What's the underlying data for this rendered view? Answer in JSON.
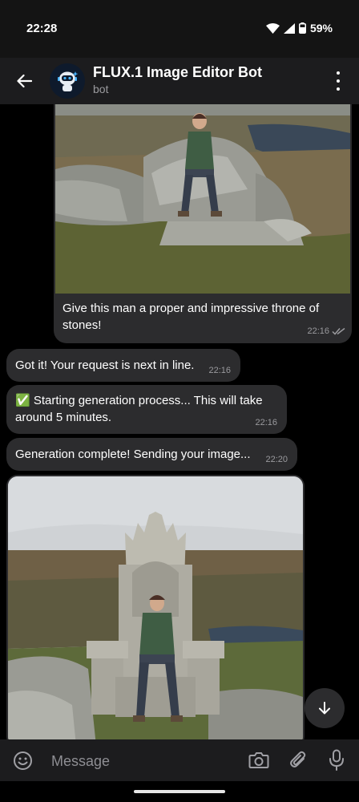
{
  "status_bar": {
    "time": "22:28",
    "battery": "59%",
    "icons": [
      "wifi-icon",
      "signal-icon",
      "battery-icon"
    ]
  },
  "header": {
    "title": "FLUX.1 Image Editor Bot",
    "subtitle": "bot",
    "icons": [
      "back-arrow-icon",
      "bot-avatar",
      "more-vert-icon"
    ]
  },
  "messages": [
    {
      "sender": "me",
      "has_image": true,
      "image_description": "man sitting on a pile of stones in a rocky moorland",
      "text": "Give this man a proper and impressive throne of stones!",
      "time": "22:16",
      "status": "read"
    },
    {
      "sender": "bot",
      "text": "Got it! Your request is next in line.",
      "time": "22:16"
    },
    {
      "sender": "bot",
      "text": "✅ Starting generation process... This will take around 5 minutes.",
      "time": "22:16"
    },
    {
      "sender": "bot",
      "text": "Generation complete! Sending your image...",
      "time": "22:20"
    },
    {
      "sender": "bot",
      "has_image": true,
      "image_description": "man sitting on a large carved stone throne in a rocky moorland"
    }
  ],
  "composer": {
    "placeholder": "Message",
    "icons": [
      "emoji-icon",
      "camera-icon",
      "paperclip-icon",
      "mic-icon"
    ]
  },
  "colors": {
    "background": "#000000",
    "bubble": "#2c2c2e",
    "header": "#1c1c1e",
    "meta_text": "#9a9a9e"
  }
}
